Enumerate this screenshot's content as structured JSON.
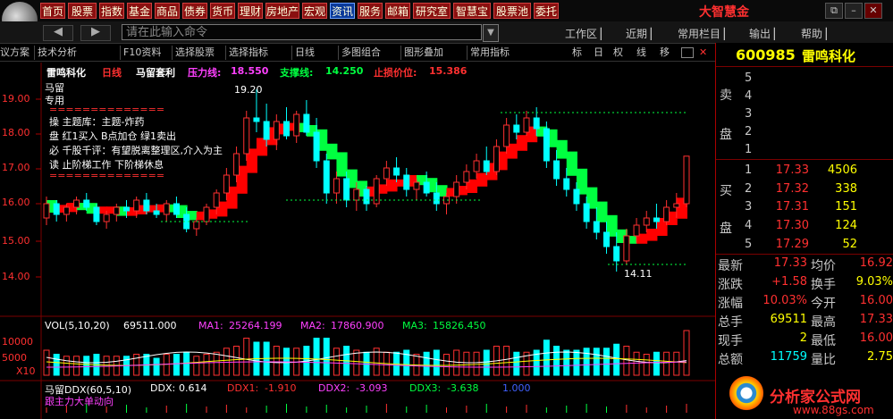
{
  "menu": {
    "items": [
      "首页",
      "股票",
      "指数",
      "基金",
      "商品",
      "债券",
      "货币",
      "理财",
      "房地产",
      "宏观",
      "资讯",
      "服务",
      "邮箱",
      "研究室",
      "智慧宝",
      "股票池",
      "委托"
    ],
    "selected": "资讯",
    "brand": "大智慧金"
  },
  "nav": {
    "back_label": "◀",
    "forward_label": "▶",
    "command_placeholder": "请在此输入命令",
    "right_items": [
      "工作区",
      "近期",
      "常用栏目",
      "输出",
      "帮助"
    ]
  },
  "toolbar": {
    "items": [
      "议方案",
      "技术分析",
      "F10资料",
      "选择股票",
      "选择指标",
      "日线",
      "多图组合",
      "图形叠加",
      "常用指标"
    ],
    "small_items": [
      "标",
      "日",
      "权",
      "线",
      "移"
    ]
  },
  "chart": {
    "header": {
      "name": "雷鸣科化",
      "period": "日线",
      "formula": "马留套利",
      "resistance_label": "压力线:",
      "resistance_value": "18.550",
      "support_label": "支撑线:",
      "support_value": "14.250",
      "stoploss_label": "止损价位:",
      "stoploss_value": "15.386"
    },
    "left_notes": [
      "马留",
      "专用"
    ],
    "info_lines": [
      "==============",
      "操 主题库：主题-炸药",
      "盘 红1买入 B点加仓 绿1卖出",
      "必 千股千评：有望脱离整理区,介入为主",
      "读 止阶梯工作 下阶梯休息",
      "=============="
    ],
    "high_label": "19.20",
    "low_label": "14.11",
    "y_ticks": [
      "19.00",
      "18.00",
      "17.00",
      "16.00",
      "15.00",
      "14.00"
    ],
    "vol_header": {
      "title": "VOL(5,10,20)",
      "vol": "69511.000",
      "ma1_label": "MA1:",
      "ma1": "25264.199",
      "ma2_label": "MA2:",
      "ma2": "17860.900",
      "ma3_label": "MA3:",
      "ma3": "15826.450"
    },
    "vol_ticks": [
      "10000",
      "5000",
      "X10"
    ],
    "ddx_header": {
      "title": "马留DDX(60,5,10)",
      "ddx_label": "DDX:",
      "ddx": "0.614",
      "ddx1_label": "DDX1:",
      "ddx1": "-1.910",
      "ddx2_label": "DDX2:",
      "ddx2": "-3.093",
      "ddx3_label": "DDX3:",
      "ddx3": "-3.638",
      "extra": "1.000"
    },
    "ddx_sub": "跟主力大单动向"
  },
  "chart_data": {
    "type": "candlestick",
    "candles": [
      [
        15.6,
        16.2,
        15.4,
        16.0
      ],
      [
        16.0,
        16.1,
        15.5,
        15.7
      ],
      [
        15.7,
        16.0,
        15.5,
        15.9
      ],
      [
        15.9,
        16.2,
        15.7,
        16.1
      ],
      [
        16.1,
        16.3,
        15.8,
        15.9
      ],
      [
        15.9,
        16.0,
        15.4,
        15.5
      ],
      [
        15.5,
        15.8,
        15.3,
        15.7
      ],
      [
        15.7,
        16.0,
        15.5,
        15.9
      ],
      [
        15.9,
        16.1,
        15.6,
        15.8
      ],
      [
        15.8,
        16.2,
        15.6,
        16.1
      ],
      [
        16.1,
        16.3,
        15.7,
        15.8
      ],
      [
        15.8,
        16.0,
        15.6,
        15.7
      ],
      [
        15.7,
        16.1,
        15.5,
        16.0
      ],
      [
        16.0,
        16.2,
        15.6,
        15.7
      ],
      [
        15.7,
        15.9,
        15.2,
        15.3
      ],
      [
        15.3,
        15.6,
        15.1,
        15.5
      ],
      [
        15.5,
        16.0,
        15.4,
        15.9
      ],
      [
        15.9,
        16.4,
        15.7,
        16.3
      ],
      [
        16.3,
        17.0,
        16.1,
        16.8
      ],
      [
        16.8,
        17.6,
        16.6,
        17.4
      ],
      [
        17.4,
        18.6,
        17.2,
        18.4
      ],
      [
        18.4,
        19.2,
        18.0,
        18.3
      ],
      [
        18.3,
        18.8,
        17.6,
        17.8
      ],
      [
        17.8,
        18.5,
        17.5,
        18.3
      ],
      [
        18.3,
        18.7,
        17.8,
        17.9
      ],
      [
        17.9,
        18.6,
        17.7,
        18.5
      ],
      [
        18.5,
        18.9,
        17.9,
        18.0
      ],
      [
        18.0,
        18.4,
        17.0,
        17.2
      ],
      [
        17.2,
        17.4,
        16.0,
        16.3
      ],
      [
        16.3,
        16.9,
        16.0,
        16.7
      ],
      [
        16.7,
        16.9,
        15.9,
        16.1
      ],
      [
        16.1,
        16.6,
        15.8,
        16.4
      ],
      [
        16.4,
        16.5,
        15.8,
        16.0
      ],
      [
        16.0,
        16.8,
        15.9,
        16.7
      ],
      [
        16.7,
        17.2,
        16.5,
        17.0
      ],
      [
        17.0,
        17.3,
        16.6,
        16.8
      ],
      [
        16.8,
        17.0,
        16.2,
        16.4
      ],
      [
        16.4,
        16.7,
        16.1,
        16.6
      ],
      [
        16.6,
        16.9,
        16.2,
        16.3
      ],
      [
        16.3,
        16.6,
        15.8,
        16.0
      ],
      [
        16.0,
        16.3,
        15.7,
        16.2
      ],
      [
        16.2,
        16.8,
        16.0,
        16.6
      ],
      [
        16.6,
        17.1,
        16.4,
        16.9
      ],
      [
        16.9,
        17.4,
        16.7,
        17.2
      ],
      [
        17.2,
        17.6,
        16.8,
        16.9
      ],
      [
        16.9,
        17.8,
        16.8,
        17.6
      ],
      [
        17.6,
        18.4,
        17.4,
        18.2
      ],
      [
        18.2,
        18.5,
        17.8,
        18.0
      ],
      [
        18.0,
        18.6,
        17.9,
        18.4
      ],
      [
        18.4,
        18.7,
        17.9,
        18.1
      ],
      [
        18.1,
        18.3,
        17.0,
        17.2
      ],
      [
        17.2,
        17.5,
        16.5,
        16.7
      ],
      [
        16.7,
        17.0,
        16.2,
        16.4
      ],
      [
        16.4,
        16.6,
        15.8,
        16.0
      ],
      [
        16.0,
        16.2,
        15.3,
        15.5
      ],
      [
        15.5,
        15.9,
        15.0,
        15.2
      ],
      [
        15.2,
        15.5,
        14.6,
        14.8
      ],
      [
        14.8,
        15.2,
        14.1,
        14.4
      ],
      [
        14.4,
        15.3,
        14.3,
        15.1
      ],
      [
        15.1,
        15.6,
        14.9,
        15.4
      ],
      [
        15.4,
        15.8,
        15.2,
        15.6
      ],
      [
        15.6,
        16.0,
        15.3,
        15.5
      ],
      [
        15.5,
        16.1,
        15.4,
        15.9
      ],
      [
        15.9,
        16.3,
        15.6,
        16.0
      ],
      [
        16.0,
        17.3,
        15.9,
        17.33
      ]
    ]
  },
  "right_panel": {
    "code": "600985",
    "name": "雷鸣科化",
    "sell_label_top": "卖",
    "sell_label_bottom": "盘",
    "buy_label_top": "买",
    "buy_label_bottom": "盘",
    "sells": [
      {
        "idx": "5",
        "price": "",
        "vol": ""
      },
      {
        "idx": "4",
        "price": "",
        "vol": ""
      },
      {
        "idx": "3",
        "price": "",
        "vol": ""
      },
      {
        "idx": "2",
        "price": "",
        "vol": ""
      },
      {
        "idx": "1",
        "price": "",
        "vol": ""
      }
    ],
    "buys": [
      {
        "idx": "1",
        "price": "17.33",
        "vol": "4506"
      },
      {
        "idx": "2",
        "price": "17.32",
        "vol": "338"
      },
      {
        "idx": "3",
        "price": "17.31",
        "vol": "151"
      },
      {
        "idx": "4",
        "price": "17.30",
        "vol": "124"
      },
      {
        "idx": "5",
        "price": "17.29",
        "vol": "52"
      }
    ],
    "stats": [
      {
        "l1": "最新",
        "v1": "17.33",
        "l2": "均价",
        "v2": "16.92"
      },
      {
        "l1": "涨跌",
        "v1": "+1.58",
        "l2": "换手",
        "v2": "9.03%"
      },
      {
        "l1": "涨幅",
        "v1": "10.03%",
        "l2": "今开",
        "v2": "16.00"
      },
      {
        "l1": "总手",
        "v1": "69511",
        "l2": "最高",
        "v2": "17.33"
      },
      {
        "l1": "现手",
        "v1": "2",
        "l2": "最低",
        "v2": "16.00"
      },
      {
        "l1": "总额",
        "v1": "11759",
        "l2": "量比",
        "v2": "2.75"
      }
    ]
  },
  "watermark": {
    "site": "分析家公式网",
    "url": "www.88gs.com"
  },
  "colors": {
    "up": "#ff3030",
    "down": "#00ffff",
    "menu_bg": "#8a1010",
    "stair_up": "#ff0000",
    "stair_down": "#00ff40"
  }
}
